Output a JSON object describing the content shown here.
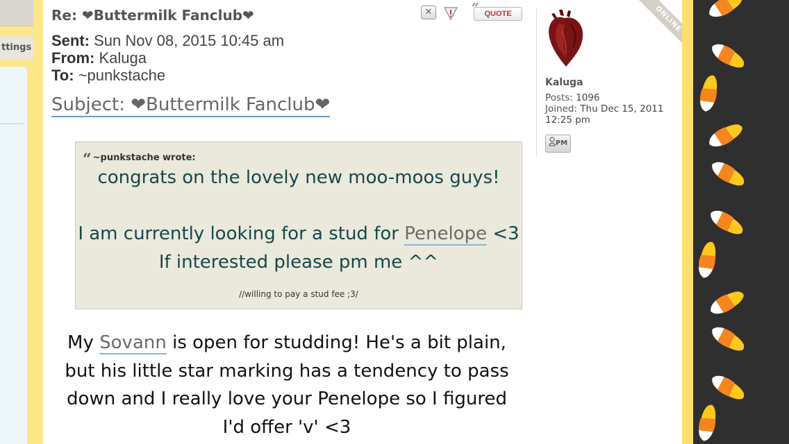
{
  "sidebar": {
    "tab_label": "ttings"
  },
  "post": {
    "title": "Re: ❤Buttermilk Fanclub❤",
    "sent_label": "Sent:",
    "sent_value": "Sun Nov 08, 2015 10:45 am",
    "from_label": "From:",
    "from_value": "Kaluga",
    "to_label": "To:",
    "to_value": "~punkstache",
    "subject": "Subject: ❤Buttermilk Fanclub❤",
    "actions": {
      "quote_label": "QUOTE"
    },
    "quote": {
      "author": "~punkstache wrote:",
      "line1": "congrats on the lovely new moo-moos guys!",
      "line2_before": "I am currently looking for a stud for ",
      "line2_link": "Penelope",
      "line2_after": " <3",
      "line3": "If interested please pm me ^^",
      "small": "//willing to pay a stud fee ;3/"
    },
    "body": {
      "before_link": "My ",
      "link": "Sovann",
      "after_link": " is open for studding! He's a bit plain, but his little star marking has a tendency to pass down and I really love your Penelope so I figured I'd offer 'v' <3"
    }
  },
  "profile": {
    "status": "ONLINE",
    "username": "Kaluga",
    "posts_label": "Posts:",
    "posts_value": "1096",
    "joined_label": "Joined:",
    "joined_value": "Thu Dec 15, 2011 12:25 pm",
    "pm_label": "PM"
  },
  "colors": {
    "accent_yellow": "#ffe06e",
    "quote_bg": "#ebe9dc",
    "quote_text": "#16474a",
    "link_underline": "#8fb4d8",
    "dark_background": "#2f2f2f",
    "candy_orange": "#f5851f",
    "candy_yellow": "#ffc81e"
  },
  "icons": {
    "report": "close-box-icon",
    "warn": "warning-triangle-icon",
    "avatar": "anatomical-heart-icon",
    "pm": "person-icon",
    "decoration": "candy-corn-icon"
  }
}
